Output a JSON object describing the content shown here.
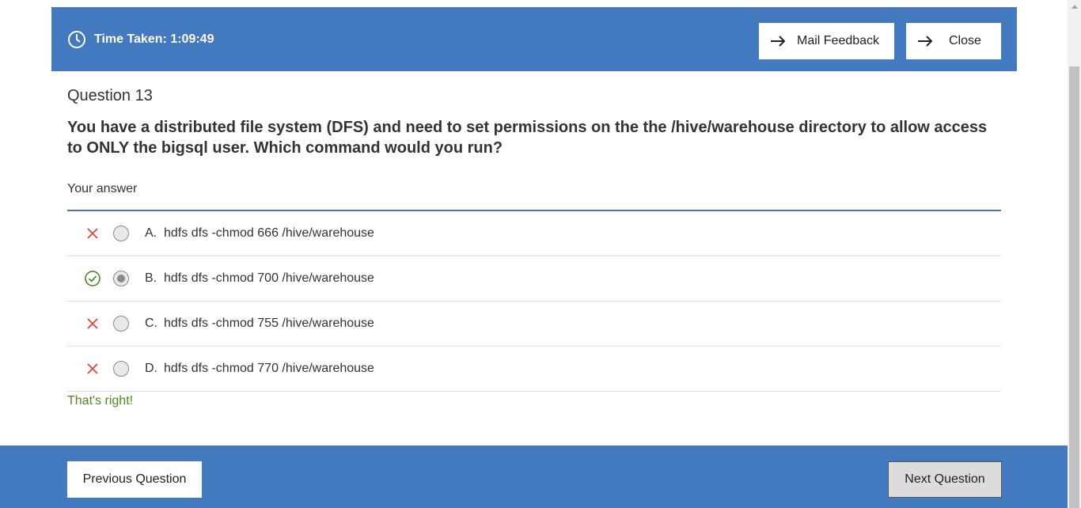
{
  "header": {
    "timer_text": "Time Taken: 1:09:49",
    "mail_feedback_label": "Mail Feedback",
    "close_label": "Close",
    "background_color": "#4279bf"
  },
  "question": {
    "number_label": "Question 13",
    "text": "You have a distributed file system (DFS) and need to set permissions on the the /hive/warehouse directory to allow access to ONLY the bigsql user. Which command would you run?"
  },
  "answer_section_label": "Your answer",
  "options": [
    {
      "letter": "A.",
      "text": "hdfs dfs -chmod 666 /hive/warehouse",
      "mark": "wrong",
      "selected": false
    },
    {
      "letter": "B.",
      "text": "hdfs dfs -chmod 700 /hive/warehouse",
      "mark": "correct",
      "selected": true
    },
    {
      "letter": "C.",
      "text": "hdfs dfs -chmod 755 /hive/warehouse",
      "mark": "wrong",
      "selected": false
    },
    {
      "letter": "D.",
      "text": "hdfs dfs -chmod 770 /hive/warehouse",
      "mark": "wrong",
      "selected": false
    }
  ],
  "feedback": {
    "text": "That's right!",
    "color": "#4d8a1e"
  },
  "footer": {
    "previous_label": "Previous Question",
    "next_label": "Next Question"
  },
  "icons": {
    "timer": "clock-icon",
    "mail_feedback": "arrow-right-icon",
    "close": "arrow-right-icon",
    "wrong": "x-icon",
    "correct": "check-circle-icon"
  }
}
